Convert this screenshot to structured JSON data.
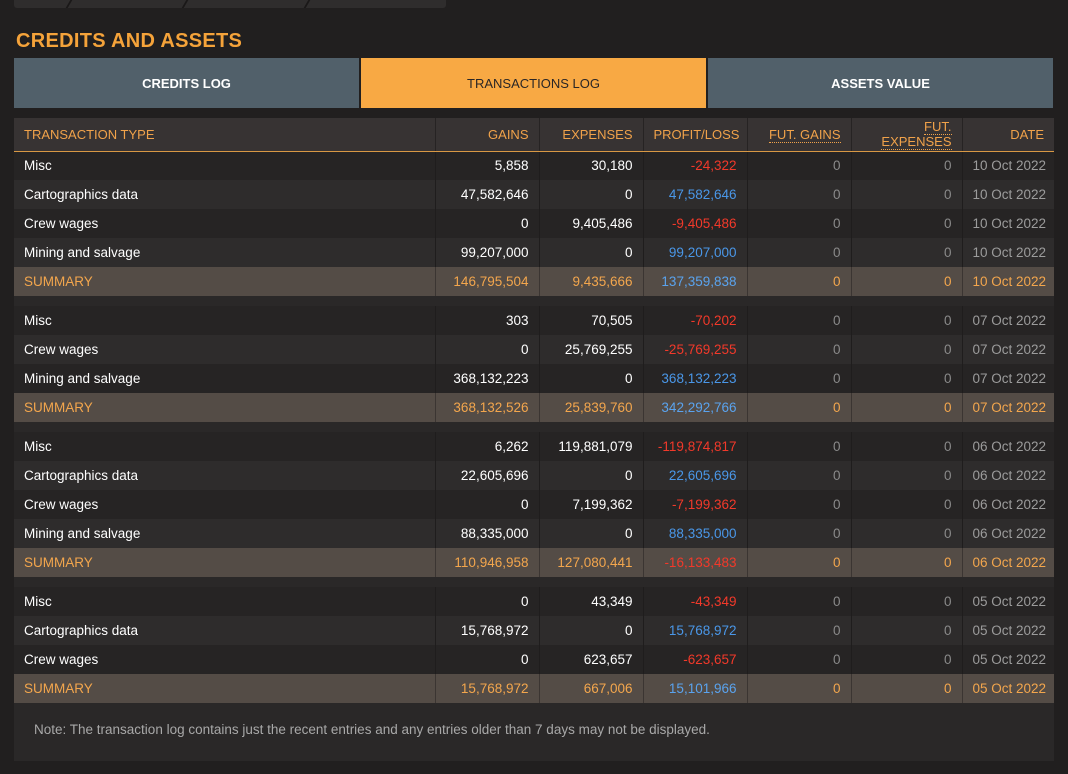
{
  "section_title": "CREDITS AND ASSETS",
  "tabs": [
    {
      "label": "CREDITS LOG",
      "active": false
    },
    {
      "label": "TRANSACTIONS LOG",
      "active": true
    },
    {
      "label": "ASSETS VALUE",
      "active": false
    }
  ],
  "table": {
    "headers": [
      "TRANSACTION TYPE",
      "GAINS",
      "EXPENSES",
      "PROFIT/LOSS",
      "FUT. GAINS",
      "FUT. EXPENSES",
      "DATE"
    ],
    "groups": [
      {
        "rows": [
          {
            "type": "Misc",
            "gains": "5,858",
            "expenses": "30,180",
            "pl": "-24,322",
            "fut_gains": "0",
            "fut_expenses": "0",
            "date": "10 Oct 2022"
          },
          {
            "type": "Cartographics data",
            "gains": "47,582,646",
            "expenses": "0",
            "pl": "47,582,646",
            "fut_gains": "0",
            "fut_expenses": "0",
            "date": "10 Oct 2022"
          },
          {
            "type": "Crew wages",
            "gains": "0",
            "expenses": "9,405,486",
            "pl": "-9,405,486",
            "fut_gains": "0",
            "fut_expenses": "0",
            "date": "10 Oct 2022"
          },
          {
            "type": "Mining and salvage",
            "gains": "99,207,000",
            "expenses": "0",
            "pl": "99,207,000",
            "fut_gains": "0",
            "fut_expenses": "0",
            "date": "10 Oct 2022"
          }
        ],
        "summary": {
          "type": "SUMMARY",
          "gains": "146,795,504",
          "expenses": "9,435,666",
          "pl": "137,359,838",
          "fut_gains": "0",
          "fut_expenses": "0",
          "date": "10 Oct 2022"
        }
      },
      {
        "rows": [
          {
            "type": "Misc",
            "gains": "303",
            "expenses": "70,505",
            "pl": "-70,202",
            "fut_gains": "0",
            "fut_expenses": "0",
            "date": "07 Oct 2022"
          },
          {
            "type": "Crew wages",
            "gains": "0",
            "expenses": "25,769,255",
            "pl": "-25,769,255",
            "fut_gains": "0",
            "fut_expenses": "0",
            "date": "07 Oct 2022"
          },
          {
            "type": "Mining and salvage",
            "gains": "368,132,223",
            "expenses": "0",
            "pl": "368,132,223",
            "fut_gains": "0",
            "fut_expenses": "0",
            "date": "07 Oct 2022"
          }
        ],
        "summary": {
          "type": "SUMMARY",
          "gains": "368,132,526",
          "expenses": "25,839,760",
          "pl": "342,292,766",
          "fut_gains": "0",
          "fut_expenses": "0",
          "date": "07 Oct 2022"
        }
      },
      {
        "rows": [
          {
            "type": "Misc",
            "gains": "6,262",
            "expenses": "119,881,079",
            "pl": "-119,874,817",
            "fut_gains": "0",
            "fut_expenses": "0",
            "date": "06 Oct 2022"
          },
          {
            "type": "Cartographics data",
            "gains": "22,605,696",
            "expenses": "0",
            "pl": "22,605,696",
            "fut_gains": "0",
            "fut_expenses": "0",
            "date": "06 Oct 2022"
          },
          {
            "type": "Crew wages",
            "gains": "0",
            "expenses": "7,199,362",
            "pl": "-7,199,362",
            "fut_gains": "0",
            "fut_expenses": "0",
            "date": "06 Oct 2022"
          },
          {
            "type": "Mining and salvage",
            "gains": "88,335,000",
            "expenses": "0",
            "pl": "88,335,000",
            "fut_gains": "0",
            "fut_expenses": "0",
            "date": "06 Oct 2022"
          }
        ],
        "summary": {
          "type": "SUMMARY",
          "gains": "110,946,958",
          "expenses": "127,080,441",
          "pl": "-16,133,483",
          "fut_gains": "0",
          "fut_expenses": "0",
          "date": "06 Oct 2022"
        }
      },
      {
        "rows": [
          {
            "type": "Misc",
            "gains": "0",
            "expenses": "43,349",
            "pl": "-43,349",
            "fut_gains": "0",
            "fut_expenses": "0",
            "date": "05 Oct 2022"
          },
          {
            "type": "Cartographics data",
            "gains": "15,768,972",
            "expenses": "0",
            "pl": "15,768,972",
            "fut_gains": "0",
            "fut_expenses": "0",
            "date": "05 Oct 2022"
          },
          {
            "type": "Crew wages",
            "gains": "0",
            "expenses": "623,657",
            "pl": "-623,657",
            "fut_gains": "0",
            "fut_expenses": "0",
            "date": "05 Oct 2022"
          }
        ],
        "summary": {
          "type": "SUMMARY",
          "gains": "15,768,972",
          "expenses": "667,006",
          "pl": "15,101,966",
          "fut_gains": "0",
          "fut_expenses": "0",
          "date": "05 Oct 2022"
        }
      }
    ]
  },
  "note": "Note: The transaction log contains just the recent entries and any entries older than 7 days may not be displayed.",
  "colors": {
    "accent": "#f8a944",
    "tab_inactive": "#51606a",
    "negative": "#f2392a",
    "positive": "#4a97e8",
    "summary_bg": "#544c46"
  }
}
